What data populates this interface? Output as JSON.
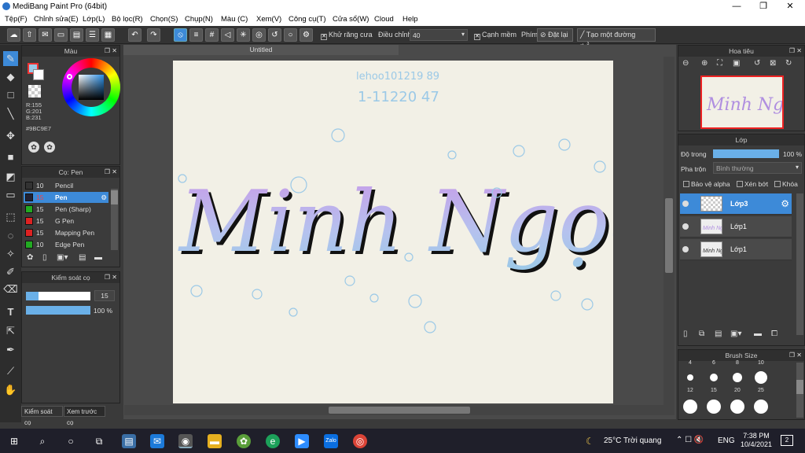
{
  "window": {
    "title": "MediBang Paint Pro (64bit)",
    "minimize": "—",
    "maximize": "❐",
    "close": "✕"
  },
  "menu": [
    "Tệp(F)",
    "Chỉnh sửa(E)",
    "Lớp(L)",
    "Bộ lọc(R)",
    "Chọn(S)",
    "Chụp(N)",
    "Màu (C)",
    "Xem(V)",
    "Công cụ(T)",
    "Cửa sổ(W)",
    "Cloud",
    "Help"
  ],
  "toolbar": {
    "antialias_label": "Khử răng cưa",
    "correction_label": "Điều chỉnh",
    "correction_value": "40",
    "edge_label": "Cạnh mềm",
    "snap_label": "Phím",
    "reset_label": "Đặt lại",
    "straight_label": "Tạo một đường thẳng"
  },
  "color_panel": {
    "title": "Màu",
    "r": "R:155",
    "g": "G:201",
    "b": "B:231",
    "hex": "#9BC9E7",
    "fg_color": "#9BC9E7"
  },
  "brush_panel": {
    "title": "Cọ: Pen",
    "brushes": [
      {
        "size": "10",
        "name": "Pencil",
        "color": "#333333"
      },
      {
        "size": "15",
        "name": "Pen",
        "color": "#222244"
      },
      {
        "size": "15",
        "name": "Pen (Sharp)",
        "color": "#22aa22"
      },
      {
        "size": "15",
        "name": "G Pen",
        "color": "#dd2222"
      },
      {
        "size": "15",
        "name": "Mapping Pen",
        "color": "#dd2222"
      },
      {
        "size": "10",
        "name": "Edge Pen",
        "color": "#22aa22"
      }
    ]
  },
  "brush_control": {
    "title": "Kiểm soát cọ",
    "size": "15",
    "opacity": "100 %",
    "size_fraction": 0.2,
    "opacity_fraction": 1.0
  },
  "bottom_tabs": {
    "brush_control": "Kiểm soát cọ",
    "preview": "Xem trước cọ"
  },
  "document": {
    "tab": "Untitled"
  },
  "canvas_text": {
    "main": "Minh Ngọc",
    "note1": "lehoo101219 89",
    "note2": "1-11220 47"
  },
  "navigator": {
    "title": "Hoa tiêu"
  },
  "layer_panel": {
    "title": "Lớp",
    "opacity_label": "Độ trong",
    "opacity_value": "100 %",
    "blend_label": "Pha trộn",
    "blend_value": "Bình thường",
    "alpha_label": "Bảo vệ alpha",
    "clip_label": "Xén bớt",
    "lock_label": "Khóa",
    "layers": [
      {
        "name": "Lớp3",
        "selected": true
      },
      {
        "name": "Lớp1",
        "selected": false
      },
      {
        "name": "Lớp1",
        "selected": false
      }
    ]
  },
  "brush_size_panel": {
    "title": "Brush Size",
    "labels_row1": [
      "4",
      "6",
      "8",
      "10"
    ],
    "labels_row2": [
      "12",
      "15",
      "20",
      "25"
    ]
  },
  "taskbar": {
    "weather": "25°C Trời quang",
    "lang": "ENG",
    "time": "7:38 PM",
    "date": "10/4/2021",
    "notif": "2"
  }
}
